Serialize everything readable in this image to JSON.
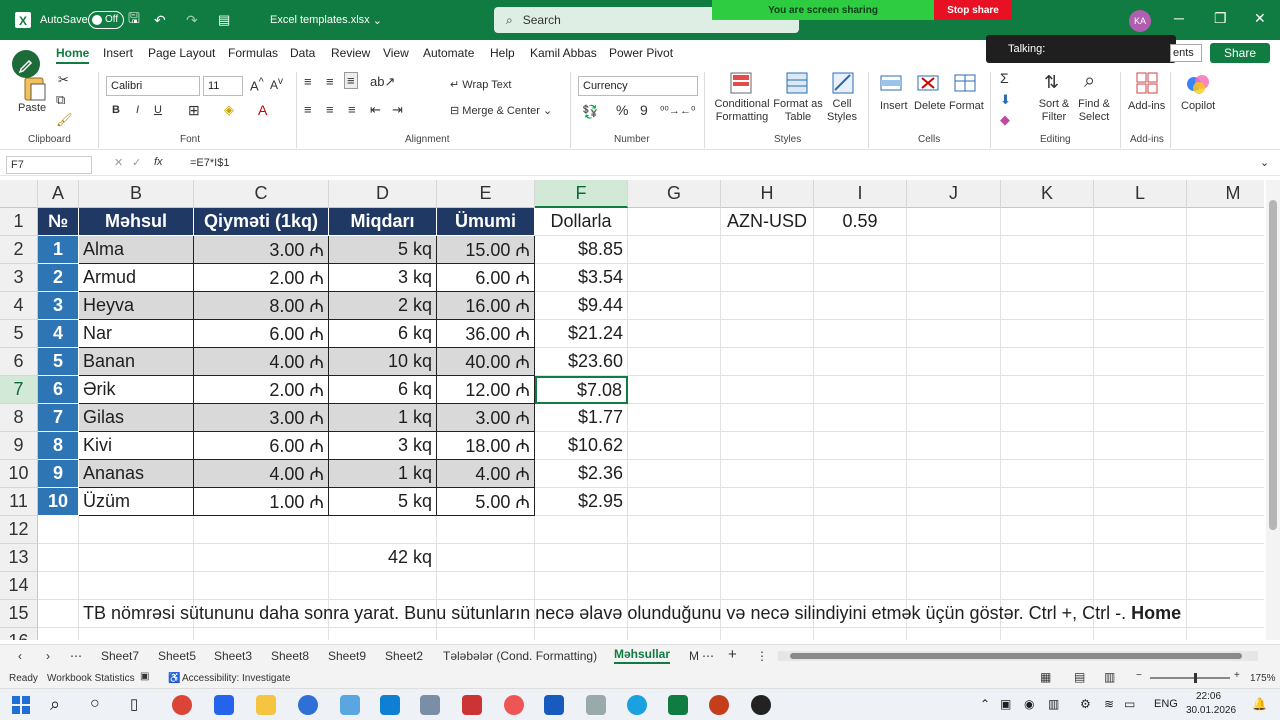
{
  "titlebar": {
    "autosave_label": "AutoSave",
    "autosave_state": "Off",
    "filename": "Excel templates.xlsx",
    "search_placeholder": "Search",
    "sharing_text": "You are screen sharing",
    "stop_share": "Stop share",
    "avatar_initials": "KA"
  },
  "talking_popup": "Talking:",
  "comments_label": "ents",
  "share_label": "Share",
  "tabs": [
    "File",
    "Home",
    "Insert",
    "Page Layout",
    "Formulas",
    "Data",
    "Review",
    "View",
    "Automate",
    "Help",
    "Kamil Abbas",
    "Power Pivot"
  ],
  "ribbon": {
    "paste": "Paste",
    "clipboard": "Clipboard",
    "font_name": "Calibri",
    "font_size": "11",
    "font_group": "Font",
    "bold": "B",
    "italic": "I",
    "underline": "U",
    "wrap_text": "Wrap Text",
    "merge_center": "Merge & Center",
    "alignment": "Alignment",
    "number_format": "Currency",
    "number": "Number",
    "conditional": "Conditional Formatting",
    "format_as_table": "Format as Table",
    "cell_styles": "Cell Styles",
    "styles": "Styles",
    "insert": "Insert",
    "delete": "Delete",
    "format": "Format",
    "cells": "Cells",
    "sort_filter": "Sort & Filter",
    "find_select": "Find & Select",
    "editing": "Editing",
    "addins": "Add-ins",
    "addins_group": "Add-ins",
    "copilot": "Copilot"
  },
  "formula_bar": {
    "name_box": "F7",
    "formula": "=E7*I$1",
    "fx": "fx"
  },
  "columns": [
    "A",
    "B",
    "C",
    "D",
    "E",
    "F",
    "G",
    "H",
    "I",
    "J",
    "K",
    "L",
    "M"
  ],
  "rows": [
    "1",
    "2",
    "3",
    "4",
    "5",
    "6",
    "7",
    "8",
    "9",
    "10",
    "11",
    "12",
    "13",
    "14",
    "15",
    "16"
  ],
  "headers": [
    "№",
    "Məhsul",
    "Qiyməti (1kq)",
    "Miqdarı",
    "Ümumi",
    "Dollarla"
  ],
  "products": [
    {
      "no": "1",
      "name": "Alma",
      "price": "3.00 ₼",
      "qty": "5 kq",
      "total": "15.00 ₼",
      "usd": "$8.85"
    },
    {
      "no": "2",
      "name": "Armud",
      "price": "2.00 ₼",
      "qty": "3 kq",
      "total": "6.00 ₼",
      "usd": "$3.54"
    },
    {
      "no": "3",
      "name": "Heyva",
      "price": "8.00 ₼",
      "qty": "2 kq",
      "total": "16.00 ₼",
      "usd": "$9.44"
    },
    {
      "no": "4",
      "name": "Nar",
      "price": "6.00 ₼",
      "qty": "6 kq",
      "total": "36.00 ₼",
      "usd": "$21.24"
    },
    {
      "no": "5",
      "name": "Banan",
      "price": "4.00 ₼",
      "qty": "10 kq",
      "total": "40.00 ₼",
      "usd": "$23.60"
    },
    {
      "no": "6",
      "name": "Ərik",
      "price": "2.00 ₼",
      "qty": "6 kq",
      "total": "12.00 ₼",
      "usd": "$7.08"
    },
    {
      "no": "7",
      "name": "Gilas",
      "price": "3.00 ₼",
      "qty": "1 kq",
      "total": "3.00 ₼",
      "usd": "$1.77"
    },
    {
      "no": "8",
      "name": "Kivi",
      "price": "6.00 ₼",
      "qty": "3 kq",
      "total": "18.00 ₼",
      "usd": "$10.62"
    },
    {
      "no": "9",
      "name": "Ananas",
      "price": "4.00 ₼",
      "qty": "1 kq",
      "total": "4.00 ₼",
      "usd": "$2.36"
    },
    {
      "no": "10",
      "name": "Üzüm",
      "price": "1.00 ₼",
      "qty": "5 kq",
      "total": "5.00 ₼",
      "usd": "$2.95"
    }
  ],
  "rate_label": "AZN-USD",
  "rate_value": "0.59",
  "sum_qty": "42 kq",
  "note": "TB nömrəsi sütununu daha sonra yarat. Bunu sütunların necə əlavə olunduğunu və necə silindiyini etmək üçün göstər. Ctrl +, Ctrl -.",
  "note_bold": "Home",
  "sheets": [
    "Sheet7",
    "Sheet5",
    "Sheet3",
    "Sheet8",
    "Sheet9",
    "Sheet2",
    "Tələbələr (Cond. Formatting)",
    "Məhsullar",
    "M"
  ],
  "status": {
    "ready": "Ready",
    "stats": "Workbook Statistics",
    "accessibility": "Accessibility: Investigate",
    "zoom": "175%"
  },
  "taskbar": {
    "lang": "ENG",
    "time": "22:06",
    "date": "30.01.2026"
  }
}
